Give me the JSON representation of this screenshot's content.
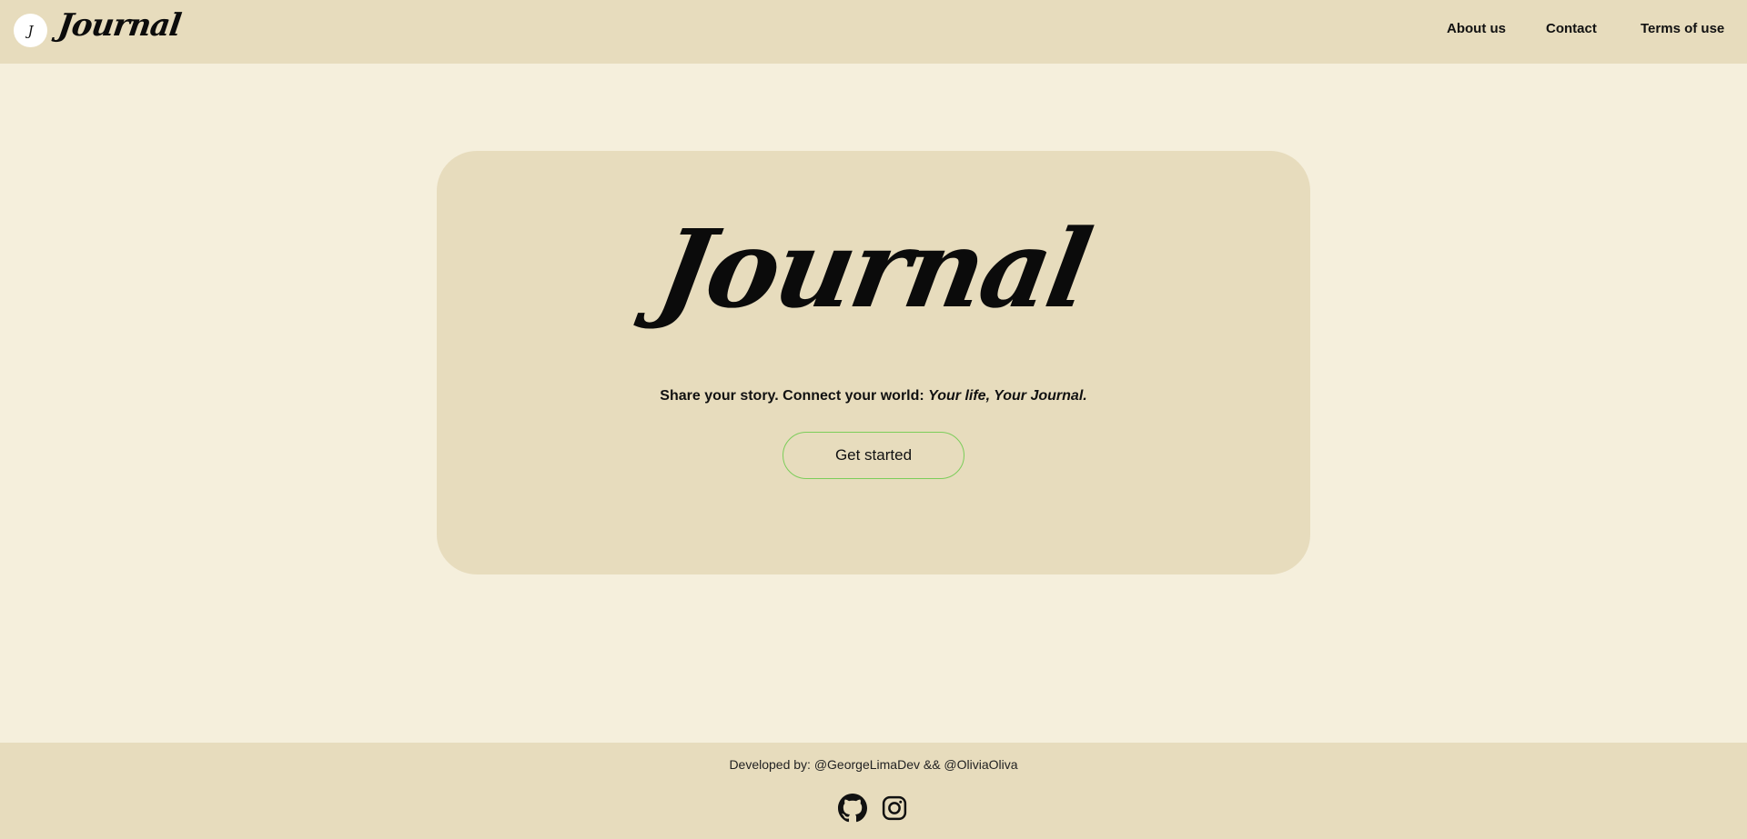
{
  "header": {
    "logo_letter": "J",
    "brand": "Journal",
    "nav": {
      "about": "About us",
      "contact": "Contact",
      "terms": "Terms of use"
    }
  },
  "hero": {
    "title": "Journal",
    "tagline_plain": "Share your story. Connect your world: ",
    "tagline_emphasis": "Your life, Your Journal.",
    "cta_label": "Get started"
  },
  "footer": {
    "credits": "Developed by: @GeorgeLimaDev && @OliviaOliva",
    "socials": [
      "github-icon",
      "instagram-icon"
    ]
  },
  "colors": {
    "page_background": "#f5efdc",
    "panel_background": "#e7dcbd",
    "cta_border": "#7ccd5a",
    "text": "#111111"
  }
}
